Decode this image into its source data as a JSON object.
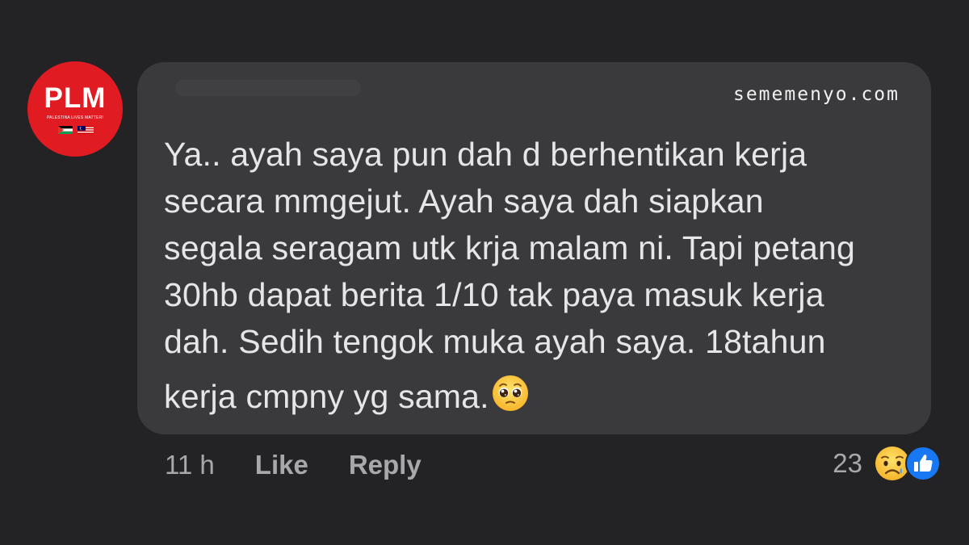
{
  "avatar": {
    "initials": "PLM",
    "tagline": "Palestina Lives Matter!",
    "icon": "plm-logo-icon",
    "flags": [
      "palestine-flag-icon",
      "malaysia-flag-icon"
    ],
    "bg_color": "#e01b22"
  },
  "watermark": "sememenyo.com",
  "comment": {
    "lines": [
      "Ya.. ayah saya pun dah d berhentikan kerja",
      "secara mmgejut. Ayah saya dah siapkan",
      "segala seragam utk krja malam ni. Tapi petang",
      "30hb dapat berita 1/10 tak paya masuk kerja",
      "dah. Sedih tengok muka ayah saya. 18tahun",
      "kerja cmpny yg sama."
    ],
    "trailing_emoji": "pleading-face-emoji"
  },
  "actions": {
    "time": "11 h",
    "like_label": "Like",
    "reply_label": "Reply"
  },
  "reactions": {
    "count": "23",
    "icons": [
      "sad-reaction-icon",
      "like-reaction-icon"
    ],
    "like_color": "#1877f2"
  },
  "colors": {
    "background": "#232325",
    "bubble": "#3a3a3c",
    "text": "#e6e6e8",
    "muted": "#a8a8ab"
  }
}
